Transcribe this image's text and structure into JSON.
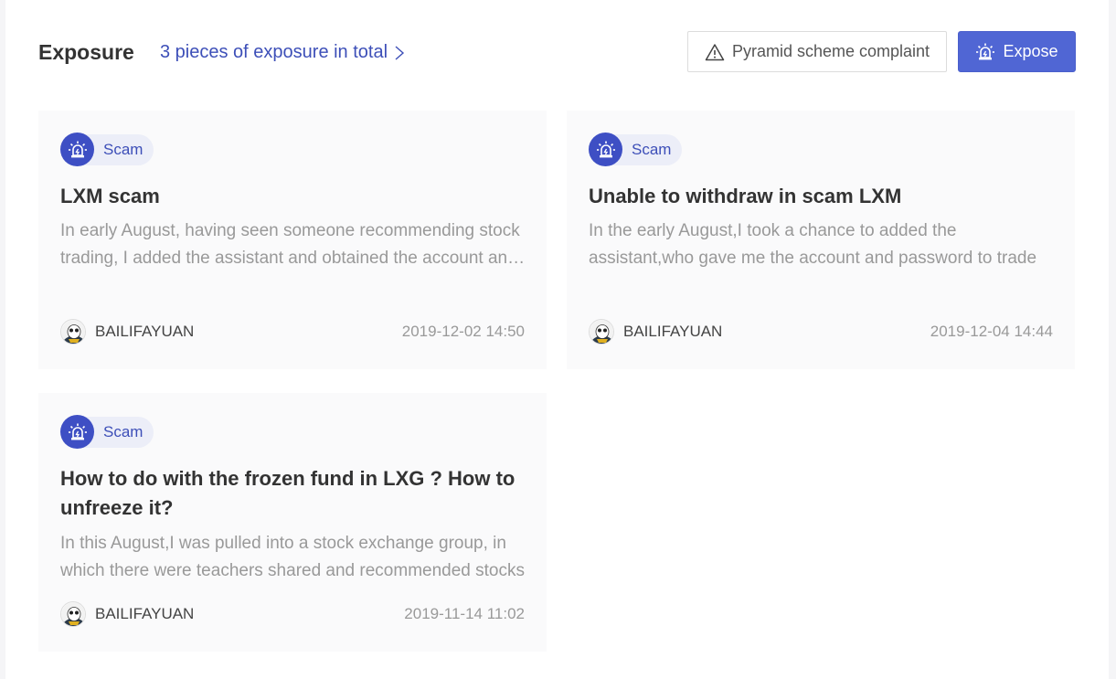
{
  "header": {
    "title": "Exposure",
    "total_link": "3 pieces of exposure in total",
    "complaint_label": "Pyramid scheme complaint",
    "expose_label": "Expose"
  },
  "colors": {
    "accent": "#3d4fb8",
    "button_primary": "#5066d4",
    "tag_bg": "#eceef8"
  },
  "cards": [
    {
      "tag": "Scam",
      "title": "LXM scam",
      "desc": "In early August, having seen someone recommending stock trading, I added the assistant and obtained the account and password to trade",
      "author": "BAILIFAYUAN",
      "time": "2019-12-02 14:50"
    },
    {
      "tag": "Scam",
      "title": "Unable to withdraw in scam LXM",
      "desc": "In the early August,I took a chance to added the assistant,who gave me the account and password to trade",
      "author": "BAILIFAYUAN",
      "time": "2019-12-04 14:44"
    },
    {
      "tag": "Scam",
      "title": "How to do with the frozen fund in LXG ? How to unfreeze it?",
      "desc": "In this August,I was pulled into a stock exchange group, in which there were teachers shared and recommended stocks",
      "author": "BAILIFAYUAN",
      "time": "2019-11-14 11:02"
    }
  ]
}
